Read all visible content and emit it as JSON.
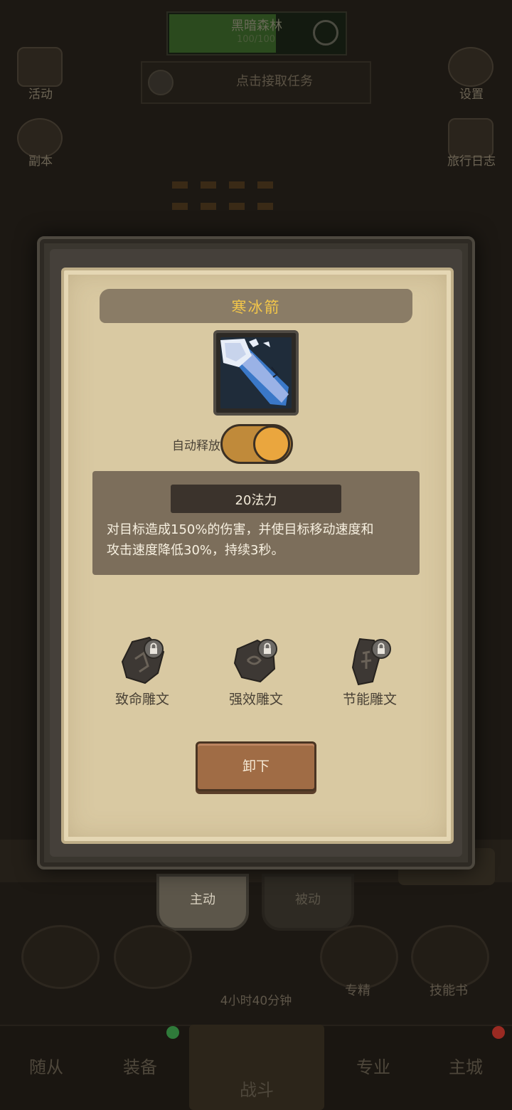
{
  "background": {
    "zone": {
      "name": "黑暗森林",
      "sub": "100/100"
    },
    "task": {
      "label": "点击接取任务"
    },
    "left_menu": [
      {
        "label": "活动",
        "icon": "event-icon"
      },
      {
        "label": "副本",
        "icon": "dungeon-icon"
      }
    ],
    "right_menu": [
      {
        "label": "设置",
        "icon": "gear-icon"
      },
      {
        "label": "旅行日志",
        "icon": "book-icon"
      }
    ],
    "skill_tabs": {
      "active": "主动",
      "inactive": "被动"
    },
    "skill_bar": {
      "timer": "4小时40分钟",
      "expert": "专精",
      "skillbook": "技能书"
    },
    "nav": {
      "follower": "随从",
      "equipment": "装备",
      "battle": "战斗",
      "profession": "专业",
      "city": "主城"
    },
    "colors": {
      "badge_green": "#2f7a3a",
      "badge_red": "#9a2a22"
    }
  },
  "modal": {
    "title": "寒冰箭",
    "icon": "ice-arrow-icon",
    "auto_cast": {
      "label": "自动释放",
      "enabled": true
    },
    "mana_cost": "20法力",
    "description_line1": "对目标造成150%的伤害，并使目标移动速度和",
    "description_line2": "攻击速度降低30%，持续3秒。",
    "runes": [
      {
        "label": "致命雕文",
        "icon": "rune-stone-icon",
        "locked": true
      },
      {
        "label": "强效雕文",
        "icon": "rune-stone-icon",
        "locked": true
      },
      {
        "label": "节能雕文",
        "icon": "rune-stone-icon",
        "locked": true
      }
    ],
    "unequip_label": "卸下",
    "colors": {
      "title": "#f2c64a",
      "parchment": "#d9c9a2",
      "toggle_on": "#eaa63e",
      "button": "#a06c45"
    }
  }
}
